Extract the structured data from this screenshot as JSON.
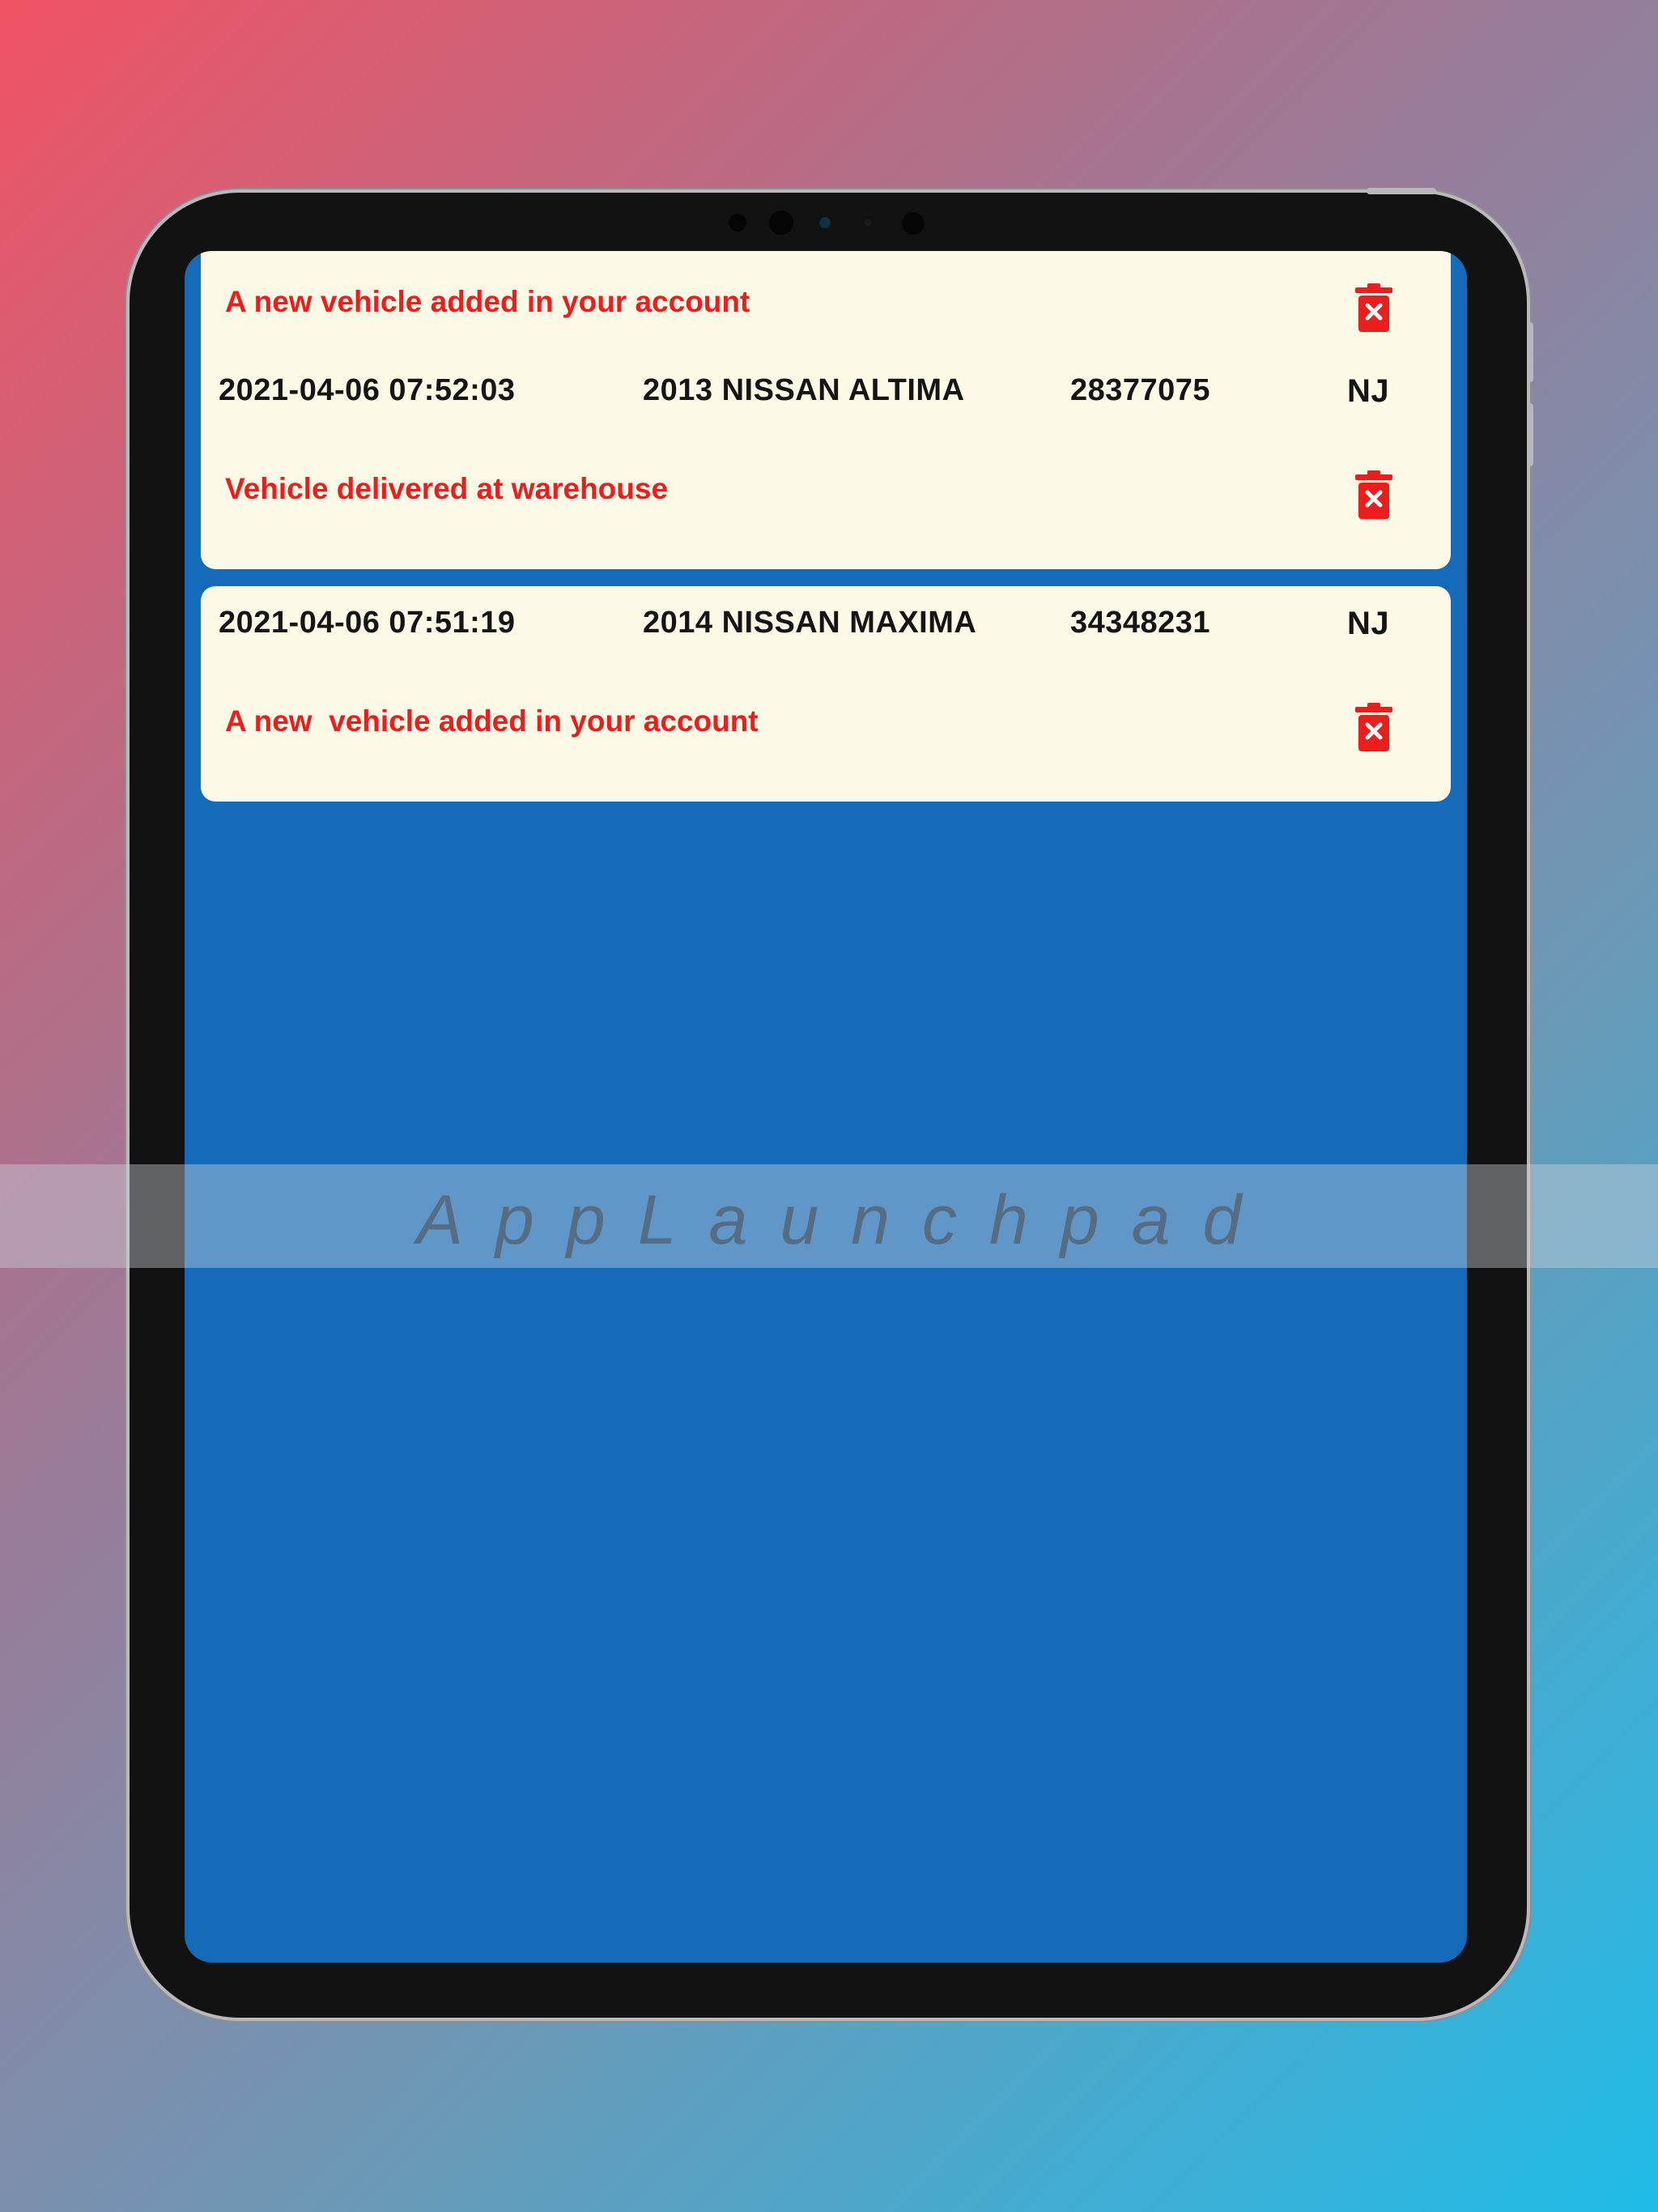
{
  "notifications": [
    {
      "timestamp": "",
      "vehicle": "",
      "number": "",
      "state": "",
      "message": "A new vehicle added in your account"
    },
    {
      "timestamp": "2021-04-06 07:52:03",
      "vehicle": "2013 NISSAN ALTIMA",
      "number": "28377075",
      "state": "NJ",
      "message": "Vehicle delivered at warehouse"
    },
    {
      "timestamp": "2021-04-06 07:51:19",
      "vehicle": "2014 NISSAN MAXIMA",
      "number": "34348231",
      "state": "NJ",
      "message": "A new  vehicle added in your account"
    }
  ],
  "icons": {
    "delete": "trash-icon"
  },
  "colors": {
    "screen_background": "#136bba",
    "card_background": "#fcf9e6",
    "message_text": "#ee1d1d",
    "trash_icon": "#ee1d1d"
  },
  "watermark": {
    "text": "AppLaunchpad"
  }
}
